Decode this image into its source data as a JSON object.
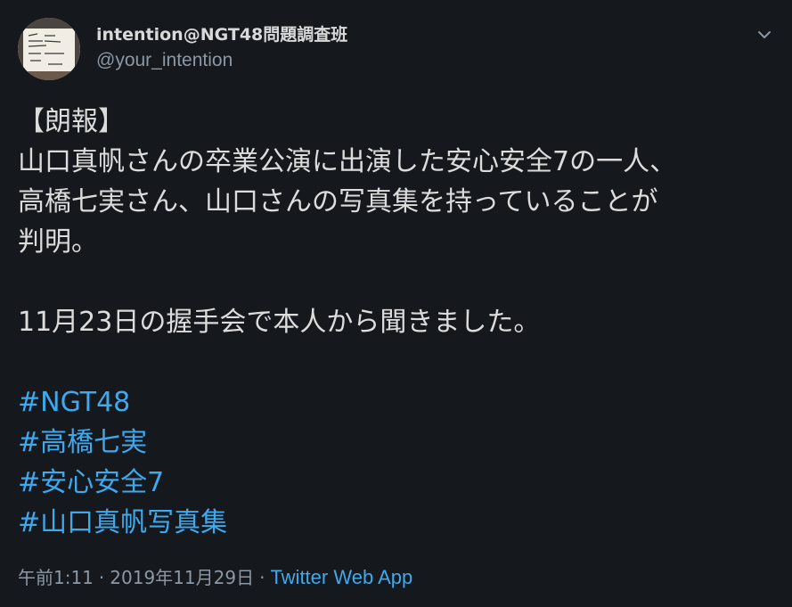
{
  "tweet": {
    "author": {
      "display_name": "intention@NGT48問題調査班",
      "handle": "@your_intention",
      "avatar_icon": "avatar-photo"
    },
    "menu_icon": "chevron-down-icon",
    "lines": [
      "【朗報】",
      "山口真帆さんの卒業公演に出演した安心安全7の一人、",
      "高橋七実さん、山口さんの写真集を持っていることが",
      "判明。",
      "",
      "11月23日の握手会で本人から聞きました。",
      ""
    ],
    "hashtags": [
      "#NGT48",
      "#高橋七実",
      "#安心安全7",
      "#山口真帆写真集"
    ],
    "meta": {
      "time": "午前1:11",
      "separator": "·",
      "date": "2019年11月29日",
      "source": "Twitter Web App"
    }
  },
  "colors": {
    "background": "#15181c",
    "text": "#dcdcdc",
    "secondary": "#8b98a5",
    "link": "#3fa9ee"
  }
}
